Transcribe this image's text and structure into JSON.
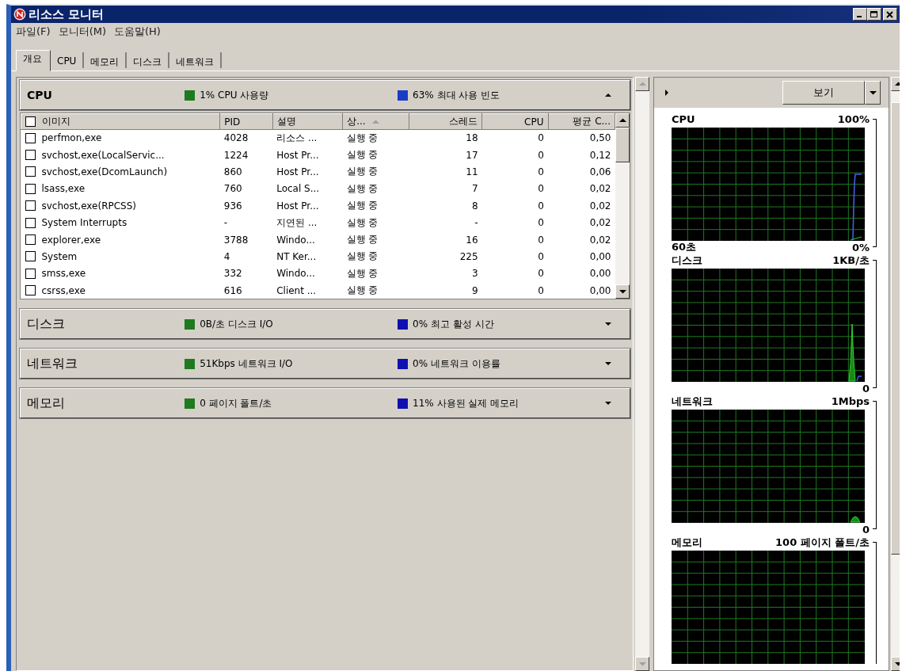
{
  "window": {
    "title": "리소스 모니터"
  },
  "menu": [
    "파일(F)",
    "모니터(M)",
    "도움말(H)"
  ],
  "tabs": [
    {
      "label": "개요",
      "selected": true
    },
    {
      "label": "CPU",
      "selected": false
    },
    {
      "label": "메모리",
      "selected": false
    },
    {
      "label": "디스크",
      "selected": false
    },
    {
      "label": "네트워크",
      "selected": false
    }
  ],
  "sections": [
    {
      "title": "CPU",
      "expanded": true,
      "stats": [
        {
          "text": "1% CPU 사용량",
          "color": "#1e7a1e"
        },
        {
          "text": "63% 최대 사용 빈도",
          "color": "#1c3cc8"
        }
      ],
      "table": {
        "select_all": {
          "checked": false
        },
        "columns": [
          {
            "label": "이미지",
            "kind": "text",
            "sorted": false
          },
          {
            "label": "PID",
            "kind": "text",
            "sorted": false
          },
          {
            "label": "설명",
            "kind": "text",
            "sorted": false
          },
          {
            "label": "상...",
            "kind": "text",
            "sorted": true
          },
          {
            "label": "스레드",
            "kind": "number",
            "sorted": false
          },
          {
            "label": "CPU",
            "kind": "number",
            "sorted": false
          },
          {
            "label": "평균 C...",
            "kind": "number",
            "sorted": false
          }
        ],
        "rows": [
          {
            "checked": false,
            "cells": [
              "perfmon,exe",
              "4028",
              "리소스 ...",
              "실행 중",
              "18",
              "0",
              "0,50"
            ]
          },
          {
            "checked": false,
            "cells": [
              "svchost,exe(LocalServic...",
              "1224",
              "Host Pr...",
              "실행 중",
              "17",
              "0",
              "0,12"
            ]
          },
          {
            "checked": false,
            "cells": [
              "svchost,exe(DcomLaunch)",
              "860",
              "Host Pr...",
              "실행 중",
              "11",
              "0",
              "0,06"
            ]
          },
          {
            "checked": false,
            "cells": [
              "lsass,exe",
              "760",
              "Local S...",
              "실행 중",
              "7",
              "0",
              "0,02"
            ]
          },
          {
            "checked": false,
            "cells": [
              "svchost,exe(RPCSS)",
              "936",
              "Host Pr...",
              "실행 중",
              "8",
              "0",
              "0,02"
            ]
          },
          {
            "checked": false,
            "cells": [
              "System Interrupts",
              "-",
              "지연된 ...",
              "실행 중",
              "-",
              "0",
              "0,02"
            ]
          },
          {
            "checked": false,
            "cells": [
              "explorer,exe",
              "3788",
              "Windo...",
              "실행 중",
              "16",
              "0",
              "0,02"
            ]
          },
          {
            "checked": false,
            "cells": [
              "System",
              "4",
              "NT Ker...",
              "실행 중",
              "225",
              "0",
              "0,00"
            ]
          },
          {
            "checked": false,
            "cells": [
              "smss,exe",
              "332",
              "Windo...",
              "실행 중",
              "3",
              "0",
              "0,00"
            ]
          },
          {
            "checked": false,
            "cells": [
              "csrss,exe",
              "616",
              "Client ...",
              "실행 중",
              "9",
              "0",
              "0,00"
            ]
          }
        ]
      }
    },
    {
      "title": "디스크",
      "expanded": false,
      "stats": [
        {
          "text": "0B/초 디스크 I/O",
          "color": "#1e7a1e"
        },
        {
          "text": "0% 최고 활성 시간",
          "color": "#1010b0"
        }
      ]
    },
    {
      "title": "네트워크",
      "expanded": false,
      "stats": [
        {
          "text": "51Kbps 네트워크 I/O",
          "color": "#1e7a1e"
        },
        {
          "text": "0% 네트워크 이용률",
          "color": "#1010b0"
        }
      ]
    },
    {
      "title": "메모리",
      "expanded": false,
      "stats": [
        {
          "text": "0 페이지 폴트/초",
          "color": "#1e7a1e"
        },
        {
          "text": "11% 사용된 실제 메모리",
          "color": "#1010b0"
        }
      ]
    }
  ],
  "graph_panel": {
    "view_button": "보기",
    "graphs": [
      {
        "title": "CPU",
        "max": "100%",
        "span": "60초",
        "min": "0%",
        "kind": "step"
      },
      {
        "title": "디스크",
        "max": "1KB/초",
        "min": "0",
        "kind": "spike"
      },
      {
        "title": "네트워크",
        "max": "1Mbps",
        "min": "0",
        "kind": "bump"
      },
      {
        "title": "메모리",
        "max": "100 페이지 폴트/초",
        "kind": "flat"
      }
    ]
  }
}
